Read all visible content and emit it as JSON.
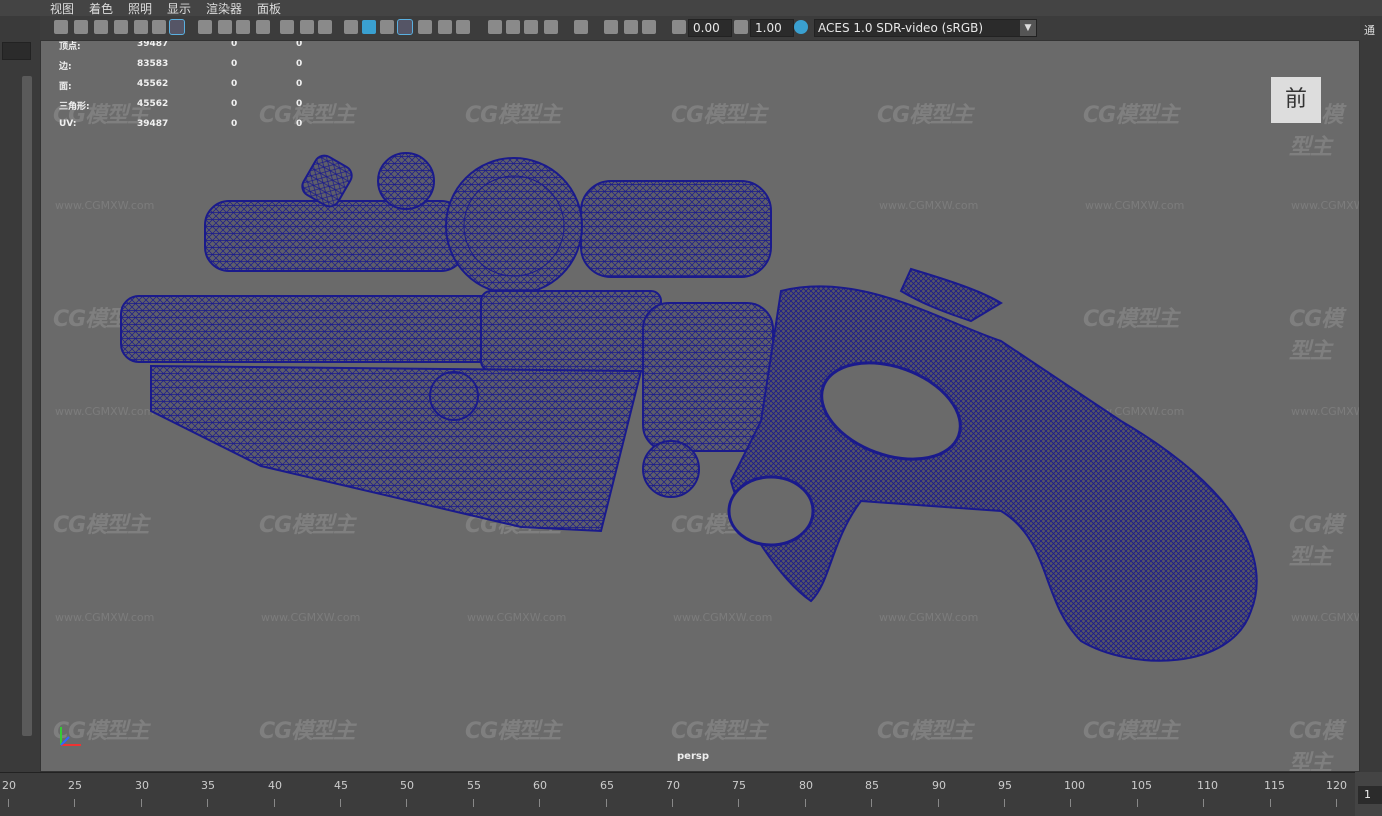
{
  "menu": [
    "视图",
    "着色",
    "照明",
    "显示",
    "渲染器",
    "面板"
  ],
  "toolbar": {
    "exposure": "0.00",
    "gamma": "1.00",
    "color_space": "ACES 1.0 SDR-video (sRGB)"
  },
  "hud": {
    "rows": [
      {
        "label": "顶点:",
        "v1": "39487",
        "v2": "0",
        "v3": "0"
      },
      {
        "label": "边:",
        "v1": "83583",
        "v2": "0",
        "v3": "0"
      },
      {
        "label": "面:",
        "v1": "45562",
        "v2": "0",
        "v3": "0"
      },
      {
        "label": "三角形:",
        "v1": "45562",
        "v2": "0",
        "v3": "0"
      },
      {
        "label": "UV:",
        "v1": "39487",
        "v2": "0",
        "v3": "0"
      }
    ]
  },
  "viewport": {
    "camera": "persp",
    "view_cube_label": "前",
    "watermark": "CG模型主",
    "watermark_url": "www.CGMXW.com"
  },
  "right_panel": {
    "label": "通"
  },
  "timeline": {
    "ticks": [
      "20",
      "25",
      "30",
      "35",
      "40",
      "45",
      "50",
      "55",
      "60",
      "65",
      "70",
      "75",
      "80",
      "85",
      "90",
      "95",
      "100",
      "105",
      "110",
      "115",
      "120"
    ],
    "current_frame": "1"
  },
  "colors": {
    "wire": "#1a1a8c",
    "viewport_bg": "#6a6a6a",
    "accent": "#3aa0d0"
  }
}
